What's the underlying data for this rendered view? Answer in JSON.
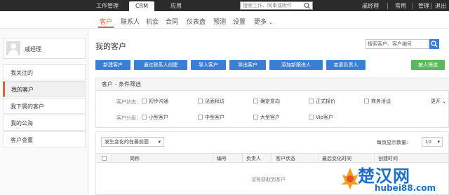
{
  "topbar": {
    "tabs": [
      {
        "label": "工作管理"
      },
      {
        "label": "CRM"
      },
      {
        "label": "应用"
      }
    ],
    "search_placeholder": "搜索工作、同事或附件",
    "user_name": "戚经理",
    "links": [
      "常用",
      "管理",
      "退出"
    ]
  },
  "nav": {
    "items": [
      "客户",
      "联系人",
      "机会",
      "合同",
      "仪表盘",
      "预测",
      "设置",
      "更多"
    ]
  },
  "sidebar": {
    "user_name": "戚经理",
    "items": [
      "我关注的",
      "我的客户",
      "我下属的客户",
      "我的公海",
      "客户查重"
    ]
  },
  "main": {
    "title": "我的客户",
    "search_placeholder": "搜索客户、客户编号",
    "buttons": [
      "新建客户",
      "通过联系人创建",
      "导入客户",
      "导出客户",
      "添加新跟进人",
      "变更负责人"
    ],
    "filter_button": "按人筛选"
  },
  "filter": {
    "title": "客户 - 条件筛选",
    "status_label": "客户状态：",
    "statuses": [
      "初步沟通",
      "见面拜访",
      "确定意向",
      "正式报价",
      "商务洽谈"
    ],
    "more_label": "更开",
    "level_label": "客户分级：",
    "levels": [
      "小型客户",
      "中型客户",
      "大型客户",
      "Vip客户"
    ]
  },
  "list": {
    "sort_value": "发生变化的在最前面",
    "per_page_label": "每页显示数量:",
    "per_page_value": "10",
    "columns": [
      "简称",
      "编号",
      "负责人",
      "客户状态",
      "最后变化时间",
      "创建时间"
    ],
    "empty_message": "没有获取到客户"
  },
  "watermark": {
    "text": "楚汉网",
    "url": "hubei88.com"
  },
  "colors": {
    "accent": "#e8602c",
    "primary": "#3a7fd5",
    "success": "#5cb85c",
    "topbar": "#2b2b2b"
  }
}
